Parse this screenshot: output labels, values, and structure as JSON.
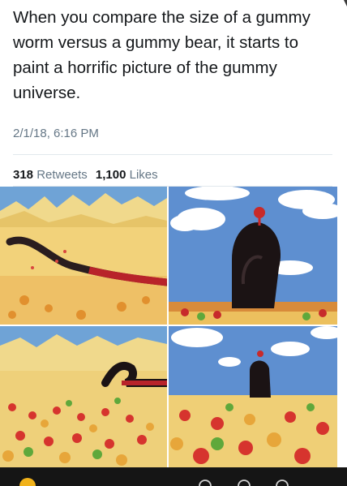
{
  "tweet": {
    "text": "When you compare the size of a gummy worm versus a gummy bear, it starts to paint a horrific picture of the gummy universe.",
    "timestamp": "2/1/18, 6:16 PM",
    "retweets_count": "318",
    "retweets_label": "Retweets",
    "likes_count": "1,100",
    "likes_label": "Likes"
  },
  "media": {
    "images": [
      {
        "name": "worm-desert-scene"
      },
      {
        "name": "worm-tower-clouds-scene"
      },
      {
        "name": "worm-over-bear-field-scene"
      },
      {
        "name": "worm-over-bear-field-closeup-scene"
      }
    ]
  },
  "colors": {
    "text": "#14171a",
    "secondary": "#657786",
    "divider": "#e1e8ed",
    "bottom_bar": "#151515"
  },
  "icons": [
    "avatar-icon",
    "reply-icon",
    "retweet-icon",
    "more-icon"
  ]
}
